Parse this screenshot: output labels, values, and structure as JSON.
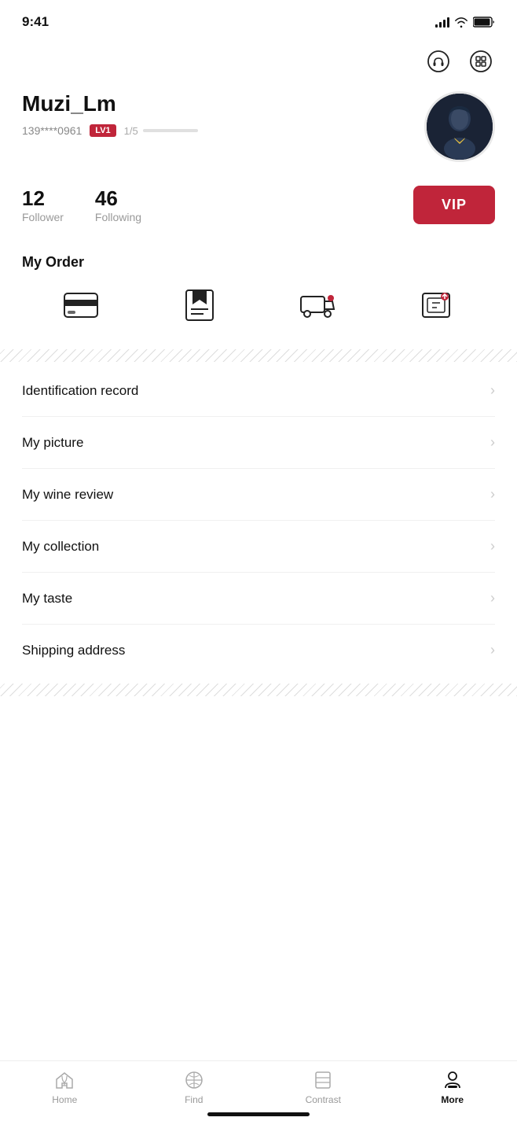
{
  "statusBar": {
    "time": "9:41"
  },
  "topActions": {
    "headsetIcon": "headset-icon",
    "scanIcon": "scan-icon"
  },
  "profile": {
    "name": "Muzi_Lm",
    "phone": "139****0961",
    "level": "LV1",
    "levelProgress": "1/5"
  },
  "stats": {
    "followerCount": "12",
    "followerLabel": "Follower",
    "followingCount": "46",
    "followingLabel": "Following",
    "vipLabel": "VIP"
  },
  "myOrder": {
    "title": "My Order"
  },
  "menuItems": [
    {
      "label": "Identification record"
    },
    {
      "label": "My picture"
    },
    {
      "label": "My wine review"
    },
    {
      "label": "My collection"
    },
    {
      "label": "My taste"
    },
    {
      "label": "Shipping address"
    }
  ],
  "bottomNav": [
    {
      "label": "Home",
      "active": false,
      "icon": "home-icon"
    },
    {
      "label": "Find",
      "active": false,
      "icon": "find-icon"
    },
    {
      "label": "Contrast",
      "active": false,
      "icon": "contrast-icon"
    },
    {
      "label": "More",
      "active": true,
      "icon": "more-icon"
    }
  ]
}
